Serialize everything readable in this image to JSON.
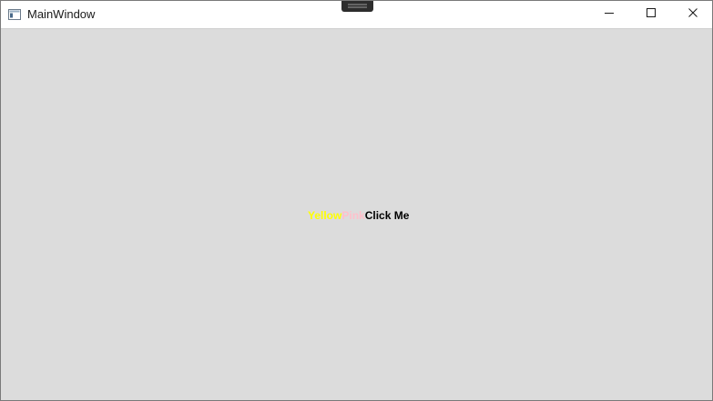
{
  "window": {
    "title": "MainWindow",
    "icon": "app-window-icon",
    "background_color": "#dcdcdc"
  },
  "caption_buttons": {
    "minimize": "minimize-icon",
    "maximize": "maximize-icon",
    "close": "close-icon"
  },
  "content": {
    "runs": [
      {
        "text": "Yellow",
        "color": "#ffff00"
      },
      {
        "text": "Pink",
        "color": "#ffc0cb"
      },
      {
        "text": "Click Me",
        "color": "#000000"
      }
    ]
  }
}
